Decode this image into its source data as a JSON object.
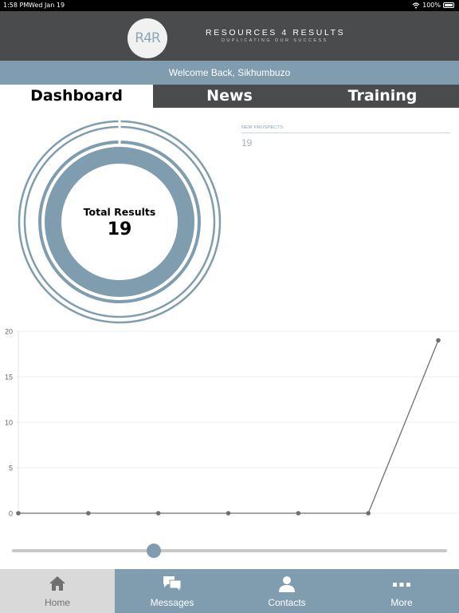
{
  "status_bar": {
    "time": "1:58 PM",
    "date": "Wed Jan 19",
    "battery": "100%"
  },
  "header": {
    "logo_text": "R4R",
    "brand": "RESOURCES 4 RESULTS",
    "tagline": "DUPLICATING OUR SUCCESS"
  },
  "welcome": "Welcome Back, Sikhumbuzo",
  "tabs": [
    {
      "label": "Dashboard",
      "active": true
    },
    {
      "label": "News",
      "active": false
    },
    {
      "label": "Training",
      "active": false
    }
  ],
  "total_results": {
    "label": "Total Results",
    "value": "19"
  },
  "new_prospects": {
    "label": "NEW PROSPECTS",
    "value": "19"
  },
  "chart_data": {
    "type": "line",
    "x": [
      1,
      2,
      3,
      4,
      5,
      6,
      7
    ],
    "series": [
      {
        "values": [
          0,
          0,
          0,
          0,
          0,
          0,
          19
        ]
      }
    ],
    "yticks": [
      "0",
      "5",
      "10",
      "15",
      "20"
    ],
    "ylim": [
      0,
      20
    ],
    "grid": true,
    "color": "#707070"
  },
  "slider": {
    "value": 0.32
  },
  "bottom_tabs": [
    {
      "label": "Home",
      "icon": "home-icon",
      "active": true
    },
    {
      "label": "Messages",
      "icon": "messages-icon",
      "active": false
    },
    {
      "label": "Contacts",
      "icon": "contacts-icon",
      "active": false
    },
    {
      "label": "More",
      "icon": "more-icon",
      "active": false
    }
  ],
  "colors": {
    "accent": "#7f9daf",
    "header": "#4a4b4d",
    "tab_active_bg": "#d9d9d9"
  }
}
